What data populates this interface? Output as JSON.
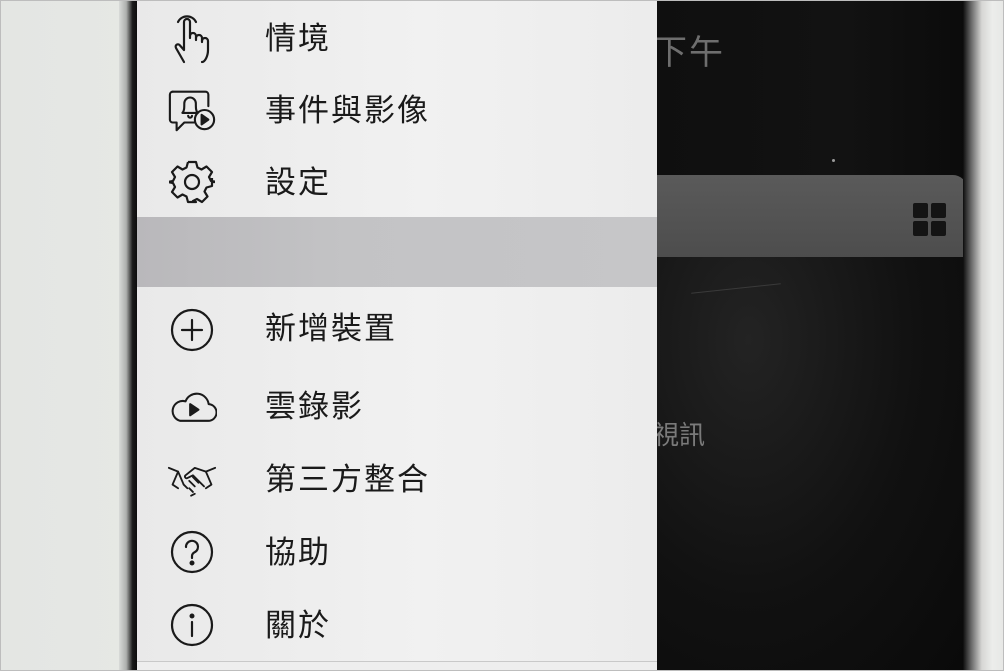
{
  "background_screen": {
    "title_fragment": "下午",
    "subtitle_fragment": "視訊",
    "grid_icon": "grid-view-icon"
  },
  "menu": {
    "items": [
      {
        "label": "情境",
        "icon": "tap-hand-icon"
      },
      {
        "label": "事件與影像",
        "icon": "event-bell-play-icon"
      },
      {
        "label": "設定",
        "icon": "gear-icon"
      },
      {
        "label": "新增裝置",
        "icon": "plus-circle-icon"
      },
      {
        "label": "雲錄影",
        "icon": "cloud-play-icon"
      },
      {
        "label": "第三方整合",
        "icon": "handshake-icon"
      },
      {
        "label": "協助",
        "icon": "question-circle-icon"
      },
      {
        "label": "關於",
        "icon": "info-circle-icon"
      }
    ]
  },
  "colors": {
    "menu_background": "#eeeeee",
    "separator_band": "#c3c3c5",
    "dark_screen": "#111111",
    "text": "#1a1a1a"
  }
}
